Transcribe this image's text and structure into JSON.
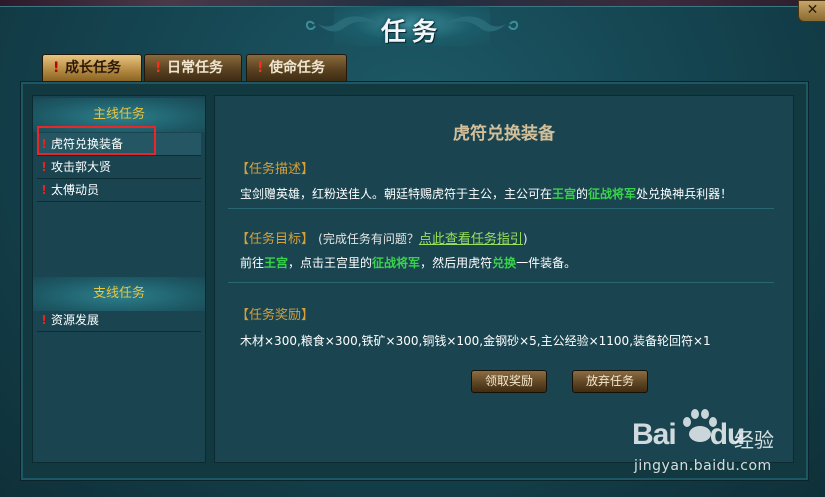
{
  "window": {
    "title": "任务",
    "close_label": "✕"
  },
  "tabs": [
    {
      "label": "成长任务",
      "active": true
    },
    {
      "label": "日常任务",
      "active": false
    },
    {
      "label": "使命任务",
      "active": false
    }
  ],
  "tab_marker": "!",
  "main_section": {
    "header": "主线任务",
    "items": [
      {
        "label": "虎符兑换装备",
        "selected": true
      },
      {
        "label": "攻击郭大贤",
        "selected": false
      },
      {
        "label": "太傅动员",
        "selected": false
      }
    ]
  },
  "side_section": {
    "header": "支线任务",
    "items": [
      {
        "label": "资源发展",
        "selected": false
      }
    ]
  },
  "quest": {
    "title": "虎符兑换装备",
    "description": {
      "label": "【任务描述】",
      "part1": "宝剑赠英雄，红粉送佳人。朝廷特赐虎符于主公，主公可在",
      "hl1": "王宫",
      "part2": "的",
      "hl2": "征战将军",
      "part3": "处兑换神兵利器！"
    },
    "objective": {
      "label": "【任务目标】",
      "hint_prefix": "(完成任务有问题？",
      "hint_link": "点此查看任务指引",
      "hint_suffix": ")",
      "part1": "前往",
      "hl1": "王宫",
      "part2": "，点击王宫里的",
      "hl2": "征战将军",
      "part3": "，然后用虎符",
      "hl3": "兑换",
      "part4": "一件装备。"
    },
    "reward": {
      "label": "【任务奖励】",
      "text": "木材×300,粮食×300,铁矿×300,铜钱×100,金钢砂×5,主公经验×1100,装备轮回符×1"
    },
    "buttons": {
      "claim": "领取奖励",
      "abandon": "放弃任务"
    }
  },
  "watermark": {
    "brand_left": "Bai",
    "brand_right": "du",
    "brand_cn": "经验",
    "url": "jingyan.baidu.com"
  },
  "colors": {
    "highlight_green": "#39d24c",
    "section_label": "#d6a03a",
    "header_gold": "#e8c540",
    "marker_red": "#e5251c"
  }
}
